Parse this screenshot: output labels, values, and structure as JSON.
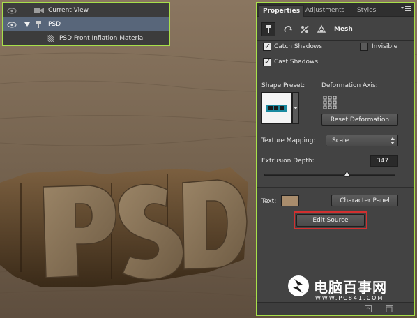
{
  "layers": {
    "rows": [
      {
        "label": "Current View",
        "type": "camera"
      },
      {
        "label": "PSD",
        "type": "3d-object"
      },
      {
        "label": "PSD Front Inflation Material",
        "type": "material"
      }
    ]
  },
  "properties": {
    "tabs": [
      "Properties",
      "Adjustments",
      "Styles"
    ],
    "active_tab": "Properties",
    "mode_label": "Mesh",
    "catch_shadows": {
      "label": "Catch Shadows",
      "checked": true
    },
    "invisible": {
      "label": "Invisible",
      "checked": false
    },
    "cast_shadows": {
      "label": "Cast Shadows",
      "checked": true
    },
    "shape_preset_label": "Shape Preset:",
    "deformation_axis_label": "Deformation Axis:",
    "reset_deformation": "Reset Deformation",
    "texture_mapping_label": "Texture Mapping:",
    "texture_mapping_value": "Scale",
    "extrusion_depth_label": "Extrusion Depth:",
    "extrusion_depth_value": "347",
    "text_label": "Text:",
    "text_color": "#a88c6c",
    "character_panel": "Character Panel",
    "edit_source": "Edit Source"
  },
  "scene": {
    "text": "PSD"
  },
  "watermark": {
    "text": "电脑百事网",
    "url": "WWW.PC841.COM"
  },
  "colors": {
    "highlight": "#a8e04a",
    "edit_source_outline": "#d23030",
    "selection": "#58667a"
  }
}
